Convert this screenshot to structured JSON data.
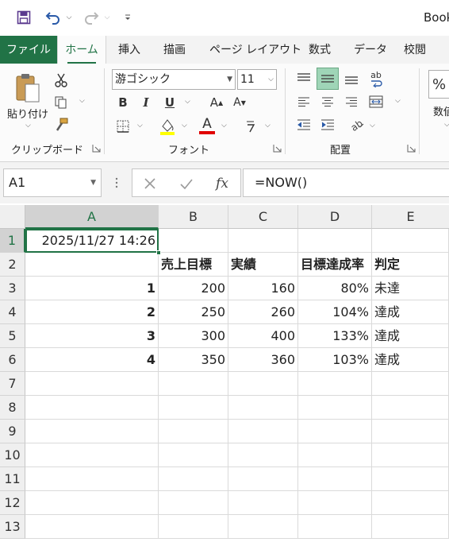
{
  "title_bar": {
    "doc_title": "Book",
    "save_icon": "save-icon",
    "undo_icon": "undo-icon",
    "redo_icon": "redo-icon",
    "customize_icon": "customize-quick-access-icon"
  },
  "ribbon_tabs": [
    "ファイル",
    "ホーム",
    "挿入",
    "描画",
    "ページ レイアウト",
    "数式",
    "データ",
    "校閲"
  ],
  "active_tab": "ホーム",
  "ribbon": {
    "clipboard": {
      "paste_label": "貼り付け",
      "group_label": "クリップボード"
    },
    "font": {
      "font_name": "游ゴシック",
      "font_size": "11",
      "group_label": "フォント",
      "bold": "B",
      "italic": "I",
      "underline": "U",
      "grow": "A",
      "shrink": "A",
      "font_color_letter": "A",
      "font_color": "#e00000",
      "fill_color": "#ffff00"
    },
    "alignment": {
      "group_label": "配置",
      "wrap_text_glyph": "ab"
    },
    "number": {
      "label_partial": "数値",
      "percent": "%"
    }
  },
  "formula_bar": {
    "name_box": "A1",
    "formula": "=NOW()",
    "fx": "fx"
  },
  "sheet": {
    "columns": [
      "A",
      "B",
      "C",
      "D",
      "E"
    ],
    "selected_column": "A",
    "rows": [
      "1",
      "2",
      "3",
      "4",
      "5",
      "6",
      "7",
      "8",
      "9",
      "10",
      "11",
      "12",
      "13"
    ],
    "selected_row": "1",
    "active_cell": "A1",
    "cells": {
      "A1": "2025/11/27 14:26",
      "B2": "売上目標",
      "C2": "実績",
      "D2": "目標達成率",
      "E2": "判定",
      "A3": "1",
      "B3": "200",
      "C3": "160",
      "D3": "80%",
      "E3": "未達",
      "A4": "2",
      "B4": "250",
      "C4": "260",
      "D4": "104%",
      "E4": "達成",
      "A5": "3",
      "B5": "300",
      "C5": "400",
      "D5": "133%",
      "E5": "達成",
      "A6": "4",
      "B6": "350",
      "C6": "360",
      "D6": "103%",
      "E6": "達成"
    }
  },
  "colors": {
    "accent": "#217346",
    "ribbon_bg": "#fbfbfb",
    "tab_bar_bg": "#f3f3f3"
  }
}
